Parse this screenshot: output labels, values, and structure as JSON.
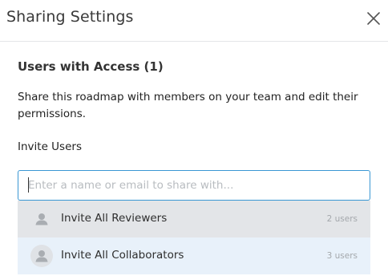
{
  "dialog": {
    "title": "Sharing Settings",
    "close_icon": "close-icon"
  },
  "access": {
    "heading": "Users with Access (1)",
    "description": "Share this roadmap with members on your team and edit their permissions."
  },
  "invite": {
    "label": "Invite Users",
    "placeholder": "Enter a name or email to share with...",
    "value": ""
  },
  "dropdown": {
    "options": [
      {
        "label": "Invite All Reviewers",
        "count": "2 users",
        "icon": "user-group-icon",
        "highlighted": false
      },
      {
        "label": "Invite All Collaborators",
        "count": "3 users",
        "icon": "user-group-icon",
        "highlighted": true
      }
    ]
  },
  "colors": {
    "input_focus_border": "#3a97d4",
    "option_hover": "#e3e5e8",
    "option_selected": "#e8f1fa"
  }
}
